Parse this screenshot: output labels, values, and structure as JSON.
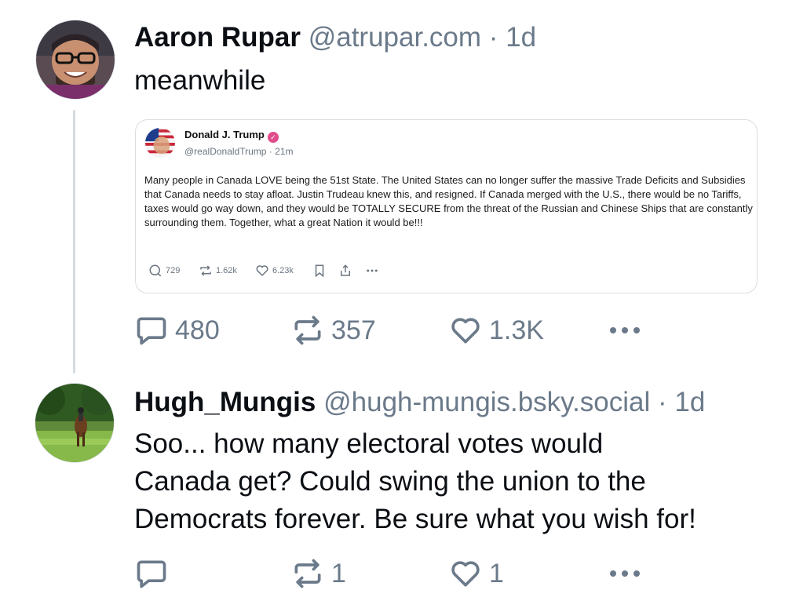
{
  "posts": [
    {
      "author": {
        "display_name": "Aaron Rupar",
        "handle": "@atrupar.com",
        "separator": "·",
        "time": "1d",
        "avatar_icon": "user-avatar-photo"
      },
      "text": "meanwhile",
      "embed": {
        "author": {
          "display_name": "Donald J. Trump",
          "verified_icon": "verified-badge-icon",
          "handle": "@realDonaldTrump",
          "separator": "·",
          "time": "21m"
        },
        "text": "Many people in Canada LOVE being the 51st State. The United States can no longer suffer the massive Trade Deficits and Subsidies that Canada needs to stay afloat. Justin Trudeau knew this, and resigned. If Canada merged with the U.S., there would be no Tariffs, taxes would go way down, and they would be TOTALLY SECURE from the threat of the Russian and Chinese Ships that are constantly surrounding them. Together, what a great Nation it would be!!!",
        "stats": {
          "replies": "729",
          "reposts": "1.62k",
          "likes": "6.23k"
        }
      },
      "actions": {
        "replies": "480",
        "reposts": "357",
        "likes": "1.3K"
      }
    },
    {
      "author": {
        "display_name": "Hugh_Mungis",
        "handle": "@hugh-mungis.bsky.social",
        "separator": "·",
        "time": "1d",
        "avatar_icon": "horse-rider-photo"
      },
      "text_lines": [
        "Soo... how many electoral votes would",
        "Canada get? Could swing the union to the",
        "Democrats forever. Be sure what you wish for!"
      ],
      "actions": {
        "replies": "",
        "reposts": "1",
        "likes": "1"
      }
    }
  ],
  "colors": {
    "muted": "#6b7a8a",
    "thread_line": "#d4dbe2",
    "verified": "#e14d8b"
  }
}
